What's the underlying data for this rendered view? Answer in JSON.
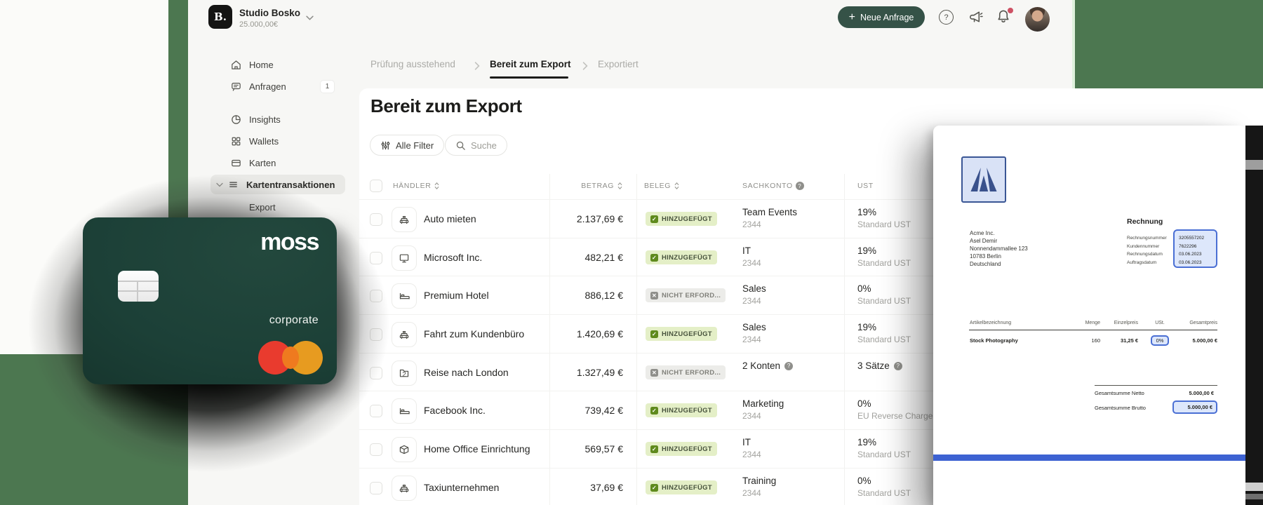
{
  "topbar": {
    "logo": "B.",
    "company": "Studio Bosko",
    "balance": "25.000,00€",
    "plus": "+",
    "new_request": "Neue Anfrage",
    "help": "?"
  },
  "sidebar": {
    "items": [
      {
        "label": "Home"
      },
      {
        "label": "Anfragen",
        "badge": "1"
      },
      {
        "label": "Insights"
      },
      {
        "label": "Wallets"
      },
      {
        "label": "Karten"
      },
      {
        "label": "Kartentransaktionen"
      },
      {
        "label": "Export"
      }
    ]
  },
  "tabs": [
    {
      "label": "Prüfung ausstehend"
    },
    {
      "label": "Bereit zum Export"
    },
    {
      "label": "Exportiert"
    }
  ],
  "page": {
    "title": "Bereit zum Export",
    "filter_button": "Alle Filter",
    "search_button": "Suche"
  },
  "table": {
    "headers": {
      "haendler": "HÄNDLER",
      "betrag": "BETRAG",
      "beleg": "BELEG",
      "sachkonto": "SACHKONTO",
      "ust": "UST"
    },
    "rows": [
      {
        "merchant": "Auto mieten",
        "amount": "2.137,69 €",
        "badge": "HINZUGEFÜGT",
        "konto": "Team Events",
        "konto_nr": "2344",
        "ust": "19%",
        "ust_sub": "Standard UST"
      },
      {
        "merchant": "Microsoft Inc.",
        "amount": "482,21 €",
        "badge": "HINZUGEFÜGT",
        "konto": "IT",
        "konto_nr": "2344",
        "ust": "19%",
        "ust_sub": "Standard UST"
      },
      {
        "merchant": "Premium Hotel",
        "amount": "886,12 €",
        "badge": "NICHT ERFORD...",
        "konto": "Sales",
        "konto_nr": "2344",
        "ust": "0%",
        "ust_sub": "Standard UST"
      },
      {
        "merchant": "Fahrt zum Kundenbüro",
        "amount": "1.420,69 €",
        "badge": "HINZUGEFÜGT",
        "konto": "Sales",
        "konto_nr": "2344",
        "ust": "19%",
        "ust_sub": "Standard UST"
      },
      {
        "merchant": "Reise nach London",
        "amount": "1.327,49 €",
        "badge": "NICHT ERFORD...",
        "konto": "2 Konten",
        "ust": "3 Sätze",
        "icon_count": "2"
      },
      {
        "merchant": "Facebook Inc.",
        "amount": "739,42 €",
        "badge": "HINZUGEFÜGT",
        "konto": "Marketing",
        "konto_nr": "2344",
        "ust": "0%",
        "ust_sub": "EU Reverse Charge"
      },
      {
        "merchant": "Home Office Einrichtung",
        "amount": "569,57 €",
        "badge": "HINZUGEFÜGT",
        "konto": "IT",
        "konto_nr": "2344",
        "ust": "19%",
        "ust_sub": "Standard UST"
      },
      {
        "merchant": "Taxiunternehmen",
        "amount": "37,69 €",
        "badge": "HINZUGEFÜGT",
        "konto": "Training",
        "konto_nr": "2344",
        "ust": "0%",
        "ust_sub": "Standard UST"
      }
    ]
  },
  "card": {
    "brand": "moss",
    "tier": "corporate"
  },
  "invoice": {
    "title": "Rechnung",
    "recipient": [
      "Acme Inc.",
      "Asel Demir",
      "Nonnendammallee 123",
      "10783 Berlin",
      "Deutschland"
    ],
    "meta": [
      {
        "label": "Rechnungsnummer",
        "value": "3205557202"
      },
      {
        "label": "Kundennummer",
        "value": "7622296"
      },
      {
        "label": "Rechnungsdatum",
        "value": "03.06.2023"
      },
      {
        "label": "Auftragsdatum",
        "value": "03.06.2023"
      }
    ],
    "items_headers": [
      "Artikelbezeichnung",
      "Menge",
      "Einzelpreis",
      "USt.",
      "Gesamtpreis"
    ],
    "items": [
      {
        "name": "Stock Photography",
        "menge": "160",
        "einzelpreis": "31,25 €",
        "ust": "0%",
        "gesamtpreis": "5.000,00 €"
      }
    ],
    "totals": [
      {
        "label": "Gesamtsumme Netto",
        "value": "5.000,00 €"
      },
      {
        "label": "Gesamtsumme Brutto",
        "value": "5.000,00 €"
      }
    ]
  },
  "colors": {
    "accent_button": "#355247",
    "badge_added_bg": "#E4EFC7",
    "badge_added_check": "#5F8A1D",
    "invoice_accent_border": "#4A6FD4",
    "invoice_accent_fill": "#DDE7FB",
    "invoice_bottom_bar": "#3D62D2",
    "card_green": "#1C4037",
    "background_green": "#4C7750",
    "notification_red": "#CE5164"
  }
}
